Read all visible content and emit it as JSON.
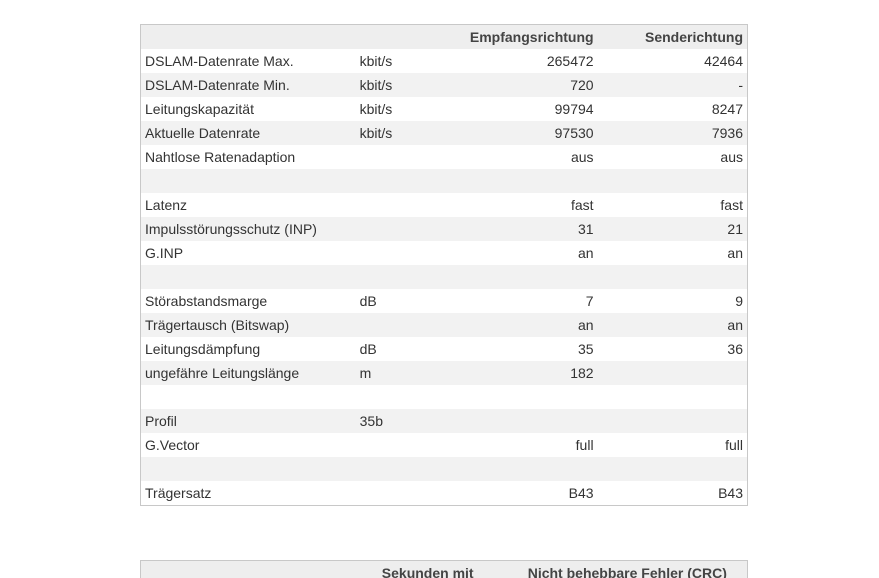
{
  "line_table": {
    "headers": {
      "label": "",
      "unit": "",
      "downstream": "Empfangsrichtung",
      "upstream": "Senderichtung"
    },
    "rows": [
      {
        "label": "DSLAM-Datenrate Max.",
        "unit": "kbit/s",
        "down": "265472",
        "up": "42464"
      },
      {
        "label": "DSLAM-Datenrate Min.",
        "unit": "kbit/s",
        "down": "720",
        "up": "-"
      },
      {
        "label": "Leitungskapazität",
        "unit": "kbit/s",
        "down": "99794",
        "up": "8247"
      },
      {
        "label": "Aktuelle Datenrate",
        "unit": "kbit/s",
        "down": "97530",
        "up": "7936"
      },
      {
        "label": "Nahtlose Ratenadaption",
        "unit": "",
        "down": "aus",
        "up": "aus"
      },
      {
        "label": "",
        "unit": "",
        "down": "",
        "up": ""
      },
      {
        "label": "Latenz",
        "unit": "",
        "down": "fast",
        "up": "fast"
      },
      {
        "label": "Impulsstörungsschutz (INP)",
        "unit": "",
        "down": "31",
        "up": "21"
      },
      {
        "label": "G.INP",
        "unit": "",
        "down": "an",
        "up": "an"
      },
      {
        "label": "",
        "unit": "",
        "down": "",
        "up": ""
      },
      {
        "label": "Störabstandsmarge",
        "unit": "dB",
        "down": "7",
        "up": "9"
      },
      {
        "label": "Trägertausch (Bitswap)",
        "unit": "",
        "down": "an",
        "up": "an"
      },
      {
        "label": "Leitungsdämpfung",
        "unit": "dB",
        "down": "35",
        "up": "36"
      },
      {
        "label": "ungefähre Leitungslänge",
        "unit": "m",
        "down": "182",
        "up": ""
      },
      {
        "label": "",
        "unit": "",
        "down": "",
        "up": ""
      },
      {
        "label": "Profil",
        "unit": "35b",
        "down": "",
        "up": ""
      },
      {
        "label": "G.Vector",
        "unit": "",
        "down": "full",
        "up": "full"
      },
      {
        "label": "",
        "unit": "",
        "down": "",
        "up": ""
      },
      {
        "label": "Trägersatz",
        "unit": "",
        "down": "B43",
        "up": "B43"
      }
    ]
  },
  "error_table": {
    "headers": {
      "col1": "",
      "col2": "Sekunden mit",
      "col3": "Nicht behebbare Fehler (CRC)"
    }
  }
}
